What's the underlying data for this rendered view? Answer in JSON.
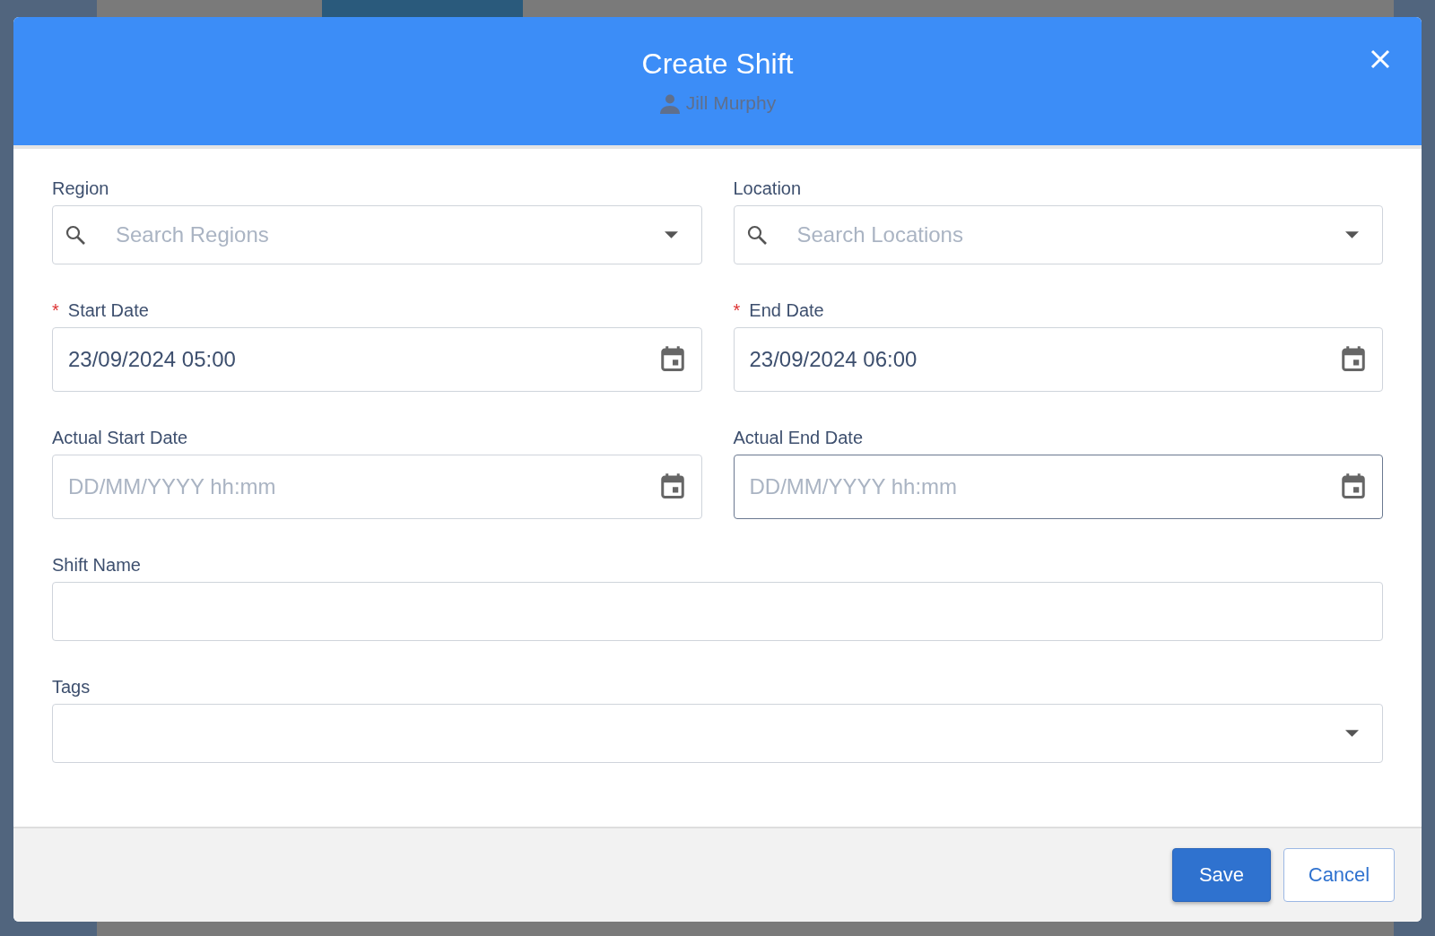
{
  "dialog": {
    "title": "Create Shift",
    "subtitle": "Jill Murphy"
  },
  "rows": [
    [
      {
        "kind": "select",
        "label": "Region",
        "placeholder": "Search Regions",
        "focused": false
      },
      {
        "kind": "select",
        "label": "Location",
        "placeholder": "Search Locations",
        "focused": false
      }
    ],
    [
      {
        "kind": "date",
        "label": "Start Date",
        "required_mark": "*",
        "value": "23/09/2024 05:00",
        "focused": false
      },
      {
        "kind": "date",
        "label": "End Date",
        "required_mark": "*",
        "value": "23/09/2024 06:00",
        "focused": false
      }
    ],
    [
      {
        "kind": "date",
        "label": "Actual Start Date",
        "placeholder": "DD/MM/YYYY hh:mm",
        "focused": false
      },
      {
        "kind": "date",
        "label": "Actual End Date",
        "placeholder": "DD/MM/YYYY hh:mm",
        "focused": true
      }
    ],
    [
      {
        "kind": "text",
        "label": "Shift Name",
        "focused": false
      }
    ],
    [
      {
        "kind": "tags",
        "label": "Tags",
        "focused": false
      }
    ]
  ],
  "buttons": [
    {
      "kind": "primary",
      "label": "Save"
    },
    {
      "kind": "secondary",
      "label": "Cancel"
    }
  ]
}
